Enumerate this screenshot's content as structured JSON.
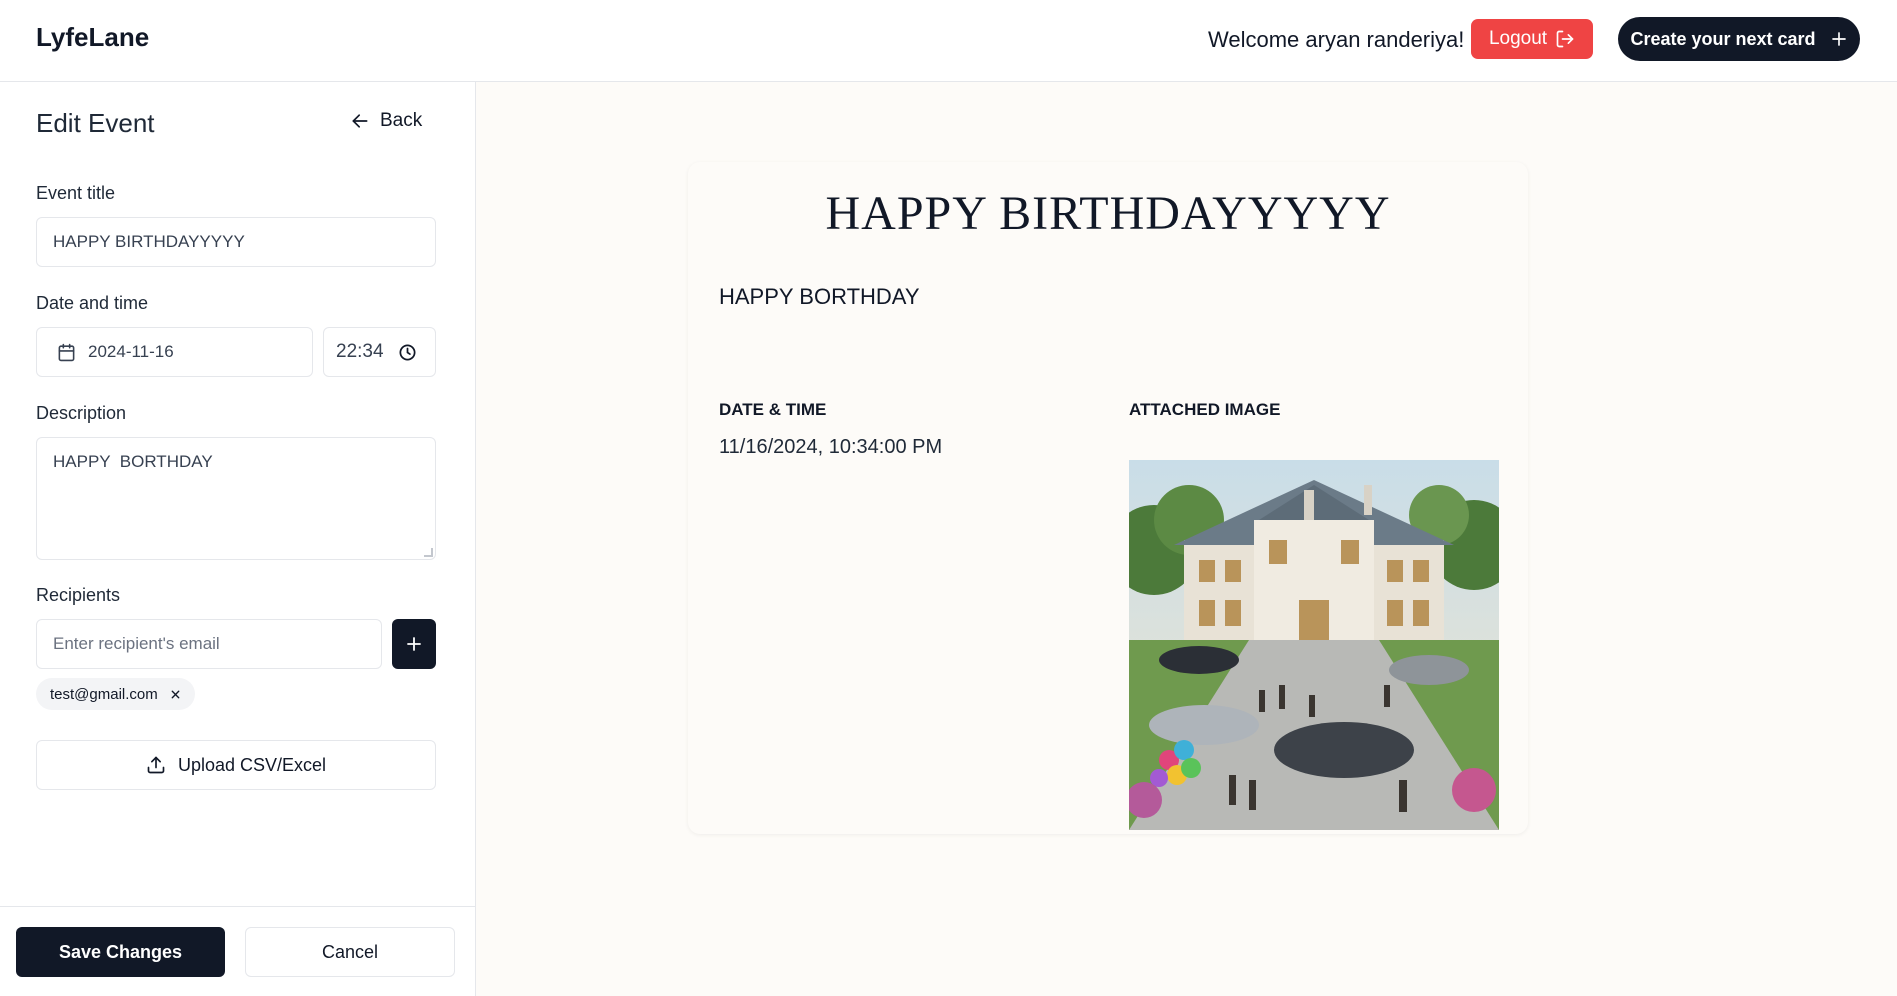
{
  "header": {
    "brand": "LyfeLane",
    "welcome": "Welcome aryan randeriya!",
    "logout_label": "Logout",
    "create_label": "Create your next card",
    "logout_color": "#ef4444",
    "primary_color": "#111827"
  },
  "sidebar": {
    "title": "Edit Event",
    "back_label": "Back",
    "event_title_label": "Event title",
    "event_title_value": "HAPPY BIRTHDAYYYYY",
    "date_time_label": "Date and time",
    "date_value": "2024-11-16",
    "time_value": "22:34",
    "description_label": "Description",
    "description_value": "HAPPY  BORTHDAY",
    "recipients_label": "Recipients",
    "recipient_placeholder": "Enter recipient's email",
    "recipients": [
      "test@gmail.com"
    ],
    "upload_label": "Upload CSV/Excel",
    "save_label": "Save Changes",
    "cancel_label": "Cancel"
  },
  "preview": {
    "title": "HAPPY BIRTHDAYYYYY",
    "description": "HAPPY BORTHDAY",
    "date_time_heading": "DATE & TIME",
    "date_time_value": "11/16/2024, 10:34:00 PM",
    "image_heading": "ATTACHED IMAGE",
    "background_color": "#fdfbf8"
  }
}
